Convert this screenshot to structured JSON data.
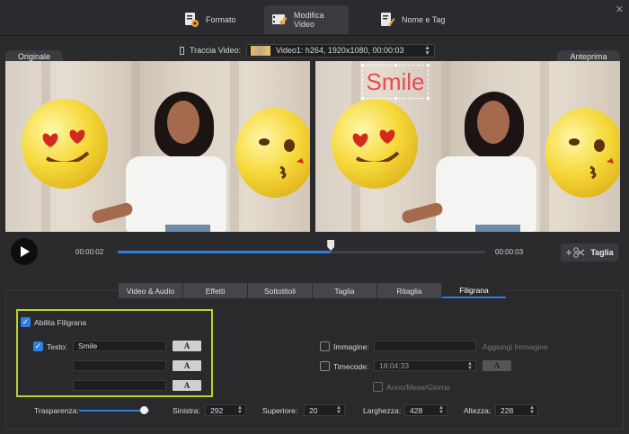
{
  "tabs": [
    {
      "label": "Formato",
      "icon": "format-icon"
    },
    {
      "label": "Modifica Video",
      "icon": "edit-video-icon",
      "active": true
    },
    {
      "label": "Nome e Tag",
      "icon": "tag-edit-icon"
    }
  ],
  "track": {
    "label": "Traccia Video:",
    "value": "Video1: h264, 1920x1080, 00:00:03"
  },
  "preview": {
    "original_label": "Originale",
    "output_label": "Anteprima",
    "watermark_text": "Smile"
  },
  "player": {
    "current_time": "00:00:02",
    "end_time": "00:00:03",
    "progress": 0.58,
    "cut_label": "Taglia"
  },
  "subtabs": [
    {
      "label": "Video & Audio"
    },
    {
      "label": "Effetti"
    },
    {
      "label": "Sottotitoli"
    },
    {
      "label": "Taglia"
    },
    {
      "label": "Ritaglia"
    },
    {
      "label": "Filigrana",
      "active": true
    }
  ],
  "watermark": {
    "enable_label": "Abilita Filigrana",
    "text_label": "Testo:",
    "text_value": "Smile",
    "font_button": "A",
    "image_label": "Immagine:",
    "add_image_label": "Aggiungi Immagine",
    "timecode_label": "Timecode:",
    "timecode_value": "18:04:33",
    "date_label": "Anno/Mese/Giorno"
  },
  "adjust": {
    "transparency_label": "Trasparenza:",
    "transparency_level": 0.92,
    "left_label": "Sinistra:",
    "left_value": "292",
    "top_label": "Superiore:",
    "top_value": "20",
    "width_label": "Larghezza:",
    "width_value": "428",
    "height_label": "Altezza:",
    "height_value": "228"
  },
  "colors": {
    "accent": "#2a7fe0",
    "highlight": "#b5d630",
    "watermark": "#e84a55"
  }
}
